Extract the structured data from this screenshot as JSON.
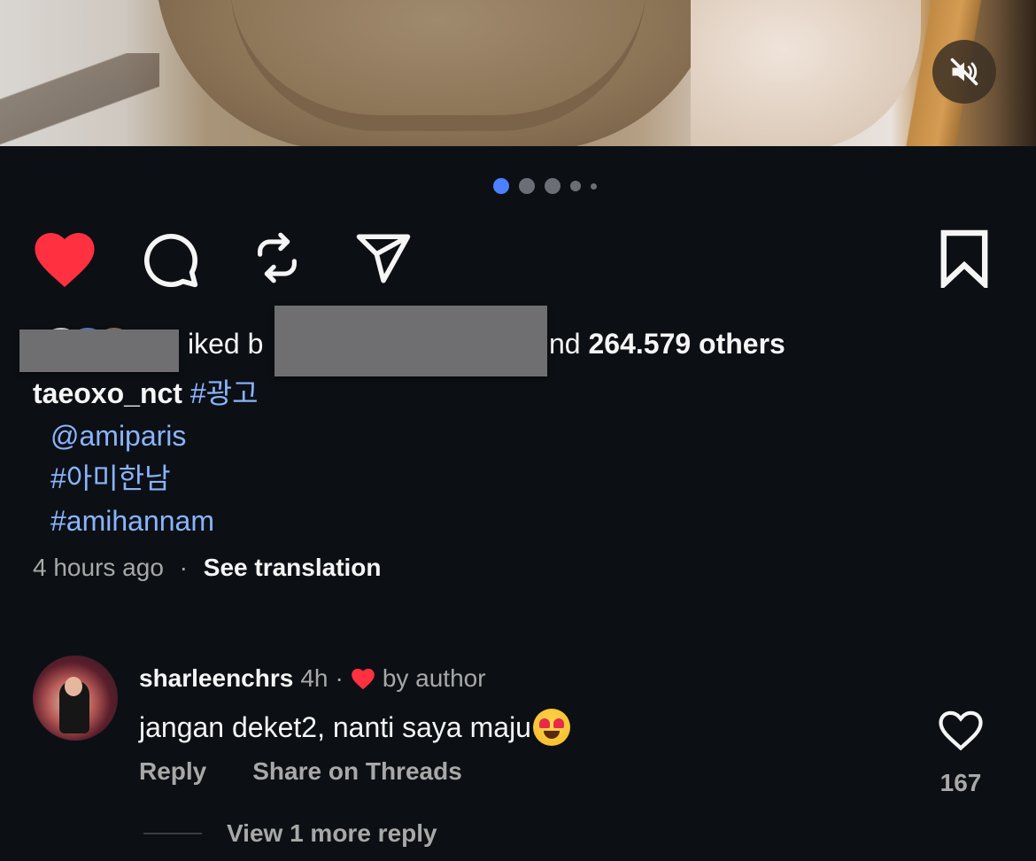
{
  "media": {
    "mute_icon": "speaker-muted-icon",
    "carousel": {
      "total": 5,
      "active_index": 0
    }
  },
  "actions": {
    "like_icon": "heart-filled-icon",
    "comment_icon": "comment-bubble-icon",
    "repost_icon": "repost-icon",
    "share_icon": "paper-plane-icon",
    "save_icon": "bookmark-icon",
    "like_color": "#ff3040"
  },
  "likes": {
    "prefix_text": "iked b",
    "suffix_text": "nd",
    "count_text": "264.579 others"
  },
  "caption": {
    "username": "taeoxo_nct",
    "tag_ad": "#광고",
    "lines": [
      "@amiparis",
      "#아미한남",
      "#amihannam"
    ]
  },
  "post_meta": {
    "time": "4 hours ago",
    "separator": "·",
    "translate_label": "See translation"
  },
  "comment": {
    "username": "sharleenchrs",
    "time": "4h",
    "separator": "·",
    "author_badge": "by author",
    "text": "jangan deket2, nanti saya maju",
    "emoji": "smiling-face-with-heart-eyes",
    "reply_label": "Reply",
    "threads_label": "Share on Threads",
    "like_count": "167",
    "view_more": "View 1 more reply"
  },
  "colors": {
    "background": "#0c1014",
    "link_blue": "#8ab4ff",
    "dot_active": "#4d80ff",
    "secondary_text": "#a8a8a8"
  }
}
